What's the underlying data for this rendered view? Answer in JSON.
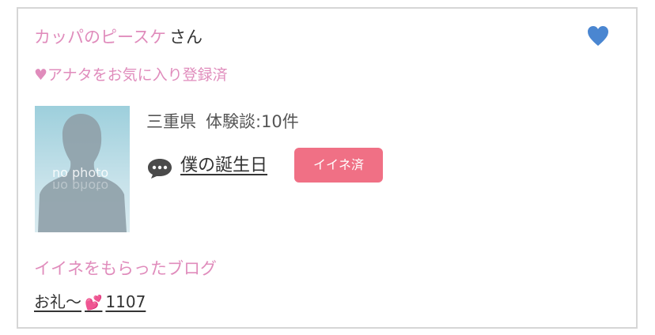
{
  "profile": {
    "name": "カッパのピースケ",
    "honorific": "さん",
    "favorite_status": "♥アナタをお気に入り登録済",
    "favorite_icon": "heart-icon",
    "photo_placeholder": "no photo",
    "prefecture": "三重県",
    "experience_label": "体験談:10件"
  },
  "entry": {
    "icon": "speech-bubble-icon",
    "title": "僕の誕生日",
    "iine_label": "イイネ済"
  },
  "blog": {
    "heading": "イイネをもらったブログ",
    "link_text_prefix": "お礼～",
    "hearts_emoji": "💕",
    "link_number": "1107"
  },
  "colors": {
    "pink_text": "#e08cbc",
    "heart_blue": "#4a86d1",
    "badge_pink": "#f07085",
    "border": "#d6d6d6"
  }
}
